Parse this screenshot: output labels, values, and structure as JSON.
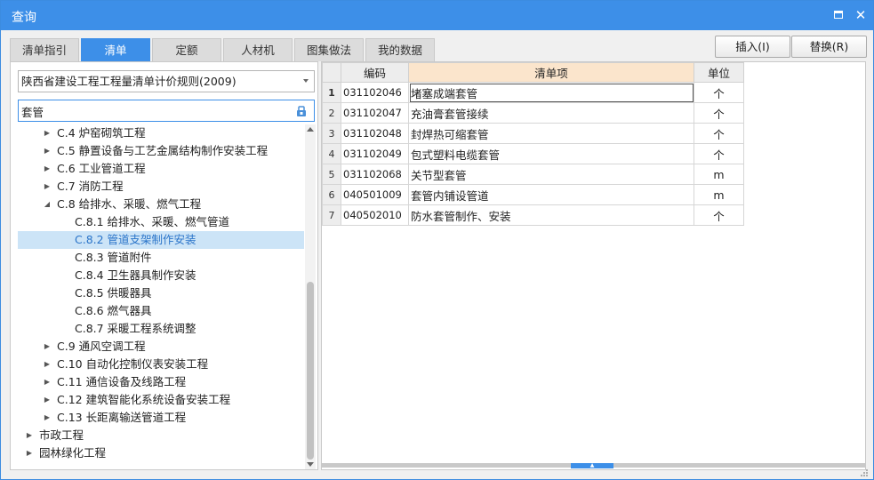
{
  "window": {
    "title": "查询"
  },
  "tabs": [
    {
      "label": "清单指引",
      "active": false
    },
    {
      "label": "清单",
      "active": true
    },
    {
      "label": "定额",
      "active": false
    },
    {
      "label": "人材机",
      "active": false
    },
    {
      "label": "图集做法",
      "active": false
    },
    {
      "label": "我的数据",
      "active": false
    }
  ],
  "actions": {
    "insert_label": "插入(I)",
    "replace_label": "替换(R)"
  },
  "rule_select": {
    "value": "陕西省建设工程工程量清单计价规则(2009)"
  },
  "search": {
    "value": "套管"
  },
  "tree": [
    {
      "label": "C.4  炉窑砌筑工程",
      "level": 1,
      "toggle": "collapsed"
    },
    {
      "label": "C.5  静置设备与工艺金属结构制作安装工程",
      "level": 1,
      "toggle": "collapsed"
    },
    {
      "label": "C.6  工业管道工程",
      "level": 1,
      "toggle": "collapsed"
    },
    {
      "label": "C.7  消防工程",
      "level": 1,
      "toggle": "collapsed"
    },
    {
      "label": "C.8  给排水、采暖、燃气工程",
      "level": 1,
      "toggle": "expanded"
    },
    {
      "label": "C.8.1  给排水、采暖、燃气管道",
      "level": 2,
      "toggle": "none"
    },
    {
      "label": "C.8.2  管道支架制作安装",
      "level": 2,
      "toggle": "none",
      "selected": true
    },
    {
      "label": "C.8.3  管道附件",
      "level": 2,
      "toggle": "none"
    },
    {
      "label": "C.8.4  卫生器具制作安装",
      "level": 2,
      "toggle": "none"
    },
    {
      "label": "C.8.5  供暖器具",
      "level": 2,
      "toggle": "none"
    },
    {
      "label": "C.8.6  燃气器具",
      "level": 2,
      "toggle": "none"
    },
    {
      "label": "C.8.7  采暖工程系统调整",
      "level": 2,
      "toggle": "none"
    },
    {
      "label": "C.9  通风空调工程",
      "level": 1,
      "toggle": "collapsed"
    },
    {
      "label": "C.10  自动化控制仪表安装工程",
      "level": 1,
      "toggle": "collapsed"
    },
    {
      "label": "C.11  通信设备及线路工程",
      "level": 1,
      "toggle": "collapsed"
    },
    {
      "label": "C.12  建筑智能化系统设备安装工程",
      "level": 1,
      "toggle": "collapsed"
    },
    {
      "label": "C.13  长距离输送管道工程",
      "level": 1,
      "toggle": "collapsed"
    },
    {
      "label": "市政工程",
      "level": 0,
      "toggle": "collapsed"
    },
    {
      "label": "园林绿化工程",
      "level": 0,
      "toggle": "collapsed"
    }
  ],
  "grid": {
    "headers": {
      "code": "编码",
      "name": "清单项",
      "unit": "单位"
    },
    "rows": [
      {
        "num": "1",
        "code": "031102046",
        "name": "堵塞成端套管",
        "unit": "个"
      },
      {
        "num": "2",
        "code": "031102047",
        "name": "充油膏套管接续",
        "unit": "个"
      },
      {
        "num": "3",
        "code": "031102048",
        "name": "封焊热可缩套管",
        "unit": "个"
      },
      {
        "num": "4",
        "code": "031102049",
        "name": "包式塑料电缆套管",
        "unit": "个"
      },
      {
        "num": "5",
        "code": "031102068",
        "name": "关节型套管",
        "unit": "m"
      },
      {
        "num": "6",
        "code": "040501009",
        "name": "套管内铺设管道",
        "unit": "m"
      },
      {
        "num": "7",
        "code": "040502010",
        "name": "防水套管制作、安装",
        "unit": "个"
      }
    ]
  },
  "colors": {
    "accent": "#3d8fe8",
    "selection": "#cce4f7",
    "header_highlight": "#fbe5cc"
  }
}
